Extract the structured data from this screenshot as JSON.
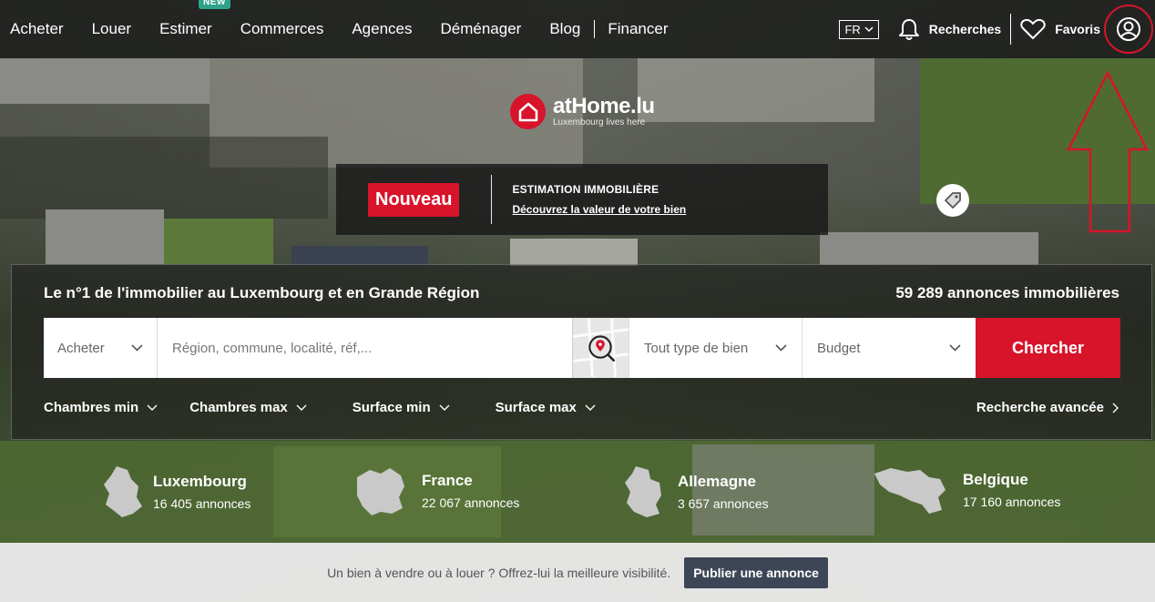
{
  "nav": {
    "links": [
      "Acheter",
      "Louer",
      "Estimer",
      "Commerces",
      "Agences",
      "Déménager",
      "Blog",
      "Financer"
    ],
    "new_badge": "NEW",
    "lang": "FR",
    "searches_label": "Recherches",
    "favorites_label": "Favoris"
  },
  "logo": {
    "title": "atHome.lu",
    "tagline": "Luxembourg lives here"
  },
  "promo": {
    "badge": "Nouveau",
    "title": "ESTIMATION IMMOBILIÈRE",
    "link": "Découvrez la valeur de votre bien"
  },
  "search": {
    "headline": "Le n°1 de l'immobilier au Luxembourg et en Grande Région",
    "count_text": "59 289 annonces immobilières",
    "mode": "Acheter",
    "location_placeholder": "Région, commune, localité, réf,...",
    "location_value": "",
    "property_type": "Tout type de bien",
    "budget": "Budget",
    "submit": "Chercher",
    "filters": [
      "Chambres min",
      "Chambres max",
      "Surface min",
      "Surface max"
    ],
    "advanced": "Recherche avancée"
  },
  "countries": [
    {
      "name": "Luxembourg",
      "count": "16 405 annonces"
    },
    {
      "name": "France",
      "count": "22 067 annonces"
    },
    {
      "name": "Allemagne",
      "count": "3 657 annonces"
    },
    {
      "name": "Belgique",
      "count": "17 160 annonces"
    }
  ],
  "footer": {
    "text": "Un bien à vendre ou à louer ? Offrez-lui la meilleure visibilité.",
    "publish": "Publier une annonce"
  },
  "colors": {
    "brand_red": "#d7142a",
    "new_badge": "#2fa38a",
    "publish_button": "#3d4656"
  }
}
